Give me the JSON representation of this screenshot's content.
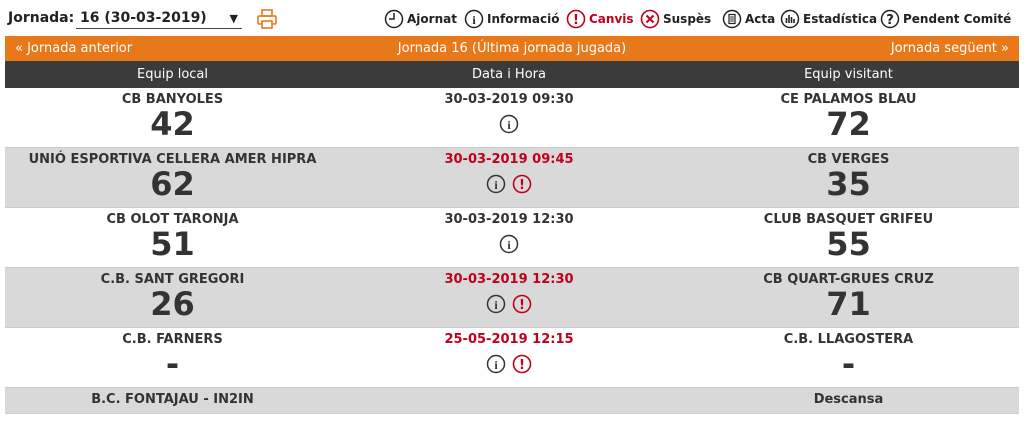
{
  "toolbar": {
    "jornada_label": "Jornada:",
    "jornada_value": "16 (30-03-2019)",
    "legend": {
      "ajornat": "Ajornat",
      "informacio": "Informació",
      "canvis": "Canvis",
      "suspes": "Suspès",
      "acta": "Acta",
      "estadistica": "Estadística",
      "pendent": "Pendent Comité"
    }
  },
  "nav": {
    "prev": "«  Jornada anterior",
    "current": "Jornada 16 (Última jornada jugada)",
    "next": "Jornada següent  »"
  },
  "table": {
    "headers": [
      "Equip local",
      "Data i Hora",
      "Equip visitant"
    ],
    "matches": [
      {
        "home": "CB BANYOLES",
        "home_score": "42",
        "datetime": "30-03-2019 09:30",
        "away": "CE PALAMOS BLAU",
        "away_score": "72"
      },
      {
        "home": "UNIÓ ESPORTIVA CELLERA AMER HIPRA",
        "home_score": "62",
        "datetime": "30-03-2019 09:45",
        "away": "CB VERGES",
        "away_score": "35"
      },
      {
        "home": "CB OLOT TARONJA",
        "home_score": "51",
        "datetime": "30-03-2019 12:30",
        "away": "CLUB BASQUET GRIFEU",
        "away_score": "55"
      },
      {
        "home": "C.B. SANT GREGORI",
        "home_score": "26",
        "datetime": "30-03-2019 12:30",
        "away": "CB QUART-GRUES CRUZ",
        "away_score": "71"
      },
      {
        "home": "C.B. FARNERS",
        "home_score": "-",
        "datetime": "25-05-2019 12:15",
        "away": "C.B. LLAGOSTERA",
        "away_score": "-"
      }
    ],
    "bye": {
      "team": "B.C. FONTAJAU - IN2IN",
      "label": "Descansa"
    }
  },
  "colors": {
    "accent": "#e8791a",
    "header_bg": "#3b3b3b",
    "changed": "#c0001a",
    "alt_row": "#d9d9d9"
  }
}
